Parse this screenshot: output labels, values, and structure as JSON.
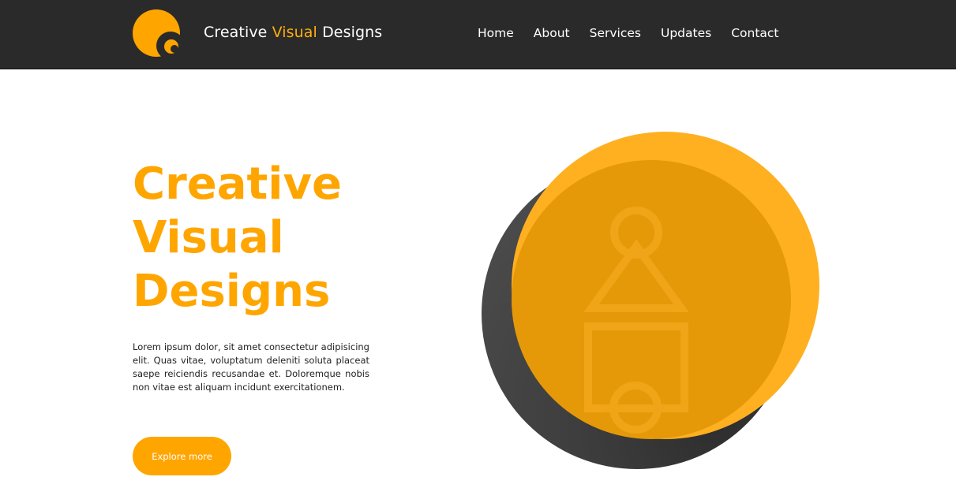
{
  "header": {
    "brand": {
      "part1": "Creative ",
      "part2": "Visual",
      "part3": " Designs"
    },
    "nav": [
      {
        "label": "Home"
      },
      {
        "label": "About"
      },
      {
        "label": "Services"
      },
      {
        "label": "Updates"
      },
      {
        "label": "Contact"
      }
    ]
  },
  "hero": {
    "title_lines": [
      "Creative",
      "Visual",
      "Designs"
    ],
    "description": "Lorem ipsum dolor, sit amet consectetur adipisicing elit. Quas vitae, voluptatum deleniti soluta placeat saepe reiciendis recusandae et. Doloremque nobis non vitae est aliquam incidunt exercitationem.",
    "cta_label": "Explore more"
  },
  "colors": {
    "navbar_bg": "#2a2a2a",
    "accent": "#ffa500",
    "dark_circle": "#3f3f3f"
  },
  "icons": {
    "logo": "brand-logo-icon",
    "hero_art": "geometric-shapes-illustration"
  }
}
